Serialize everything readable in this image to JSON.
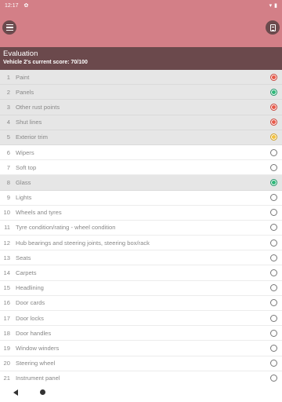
{
  "status_bar": {
    "time": "12:17"
  },
  "header": {
    "title": "Evaluation",
    "score_text": "Vehicle 2's current score: 70/100"
  },
  "items": [
    {
      "num": "1",
      "label": "Paint",
      "status": "red"
    },
    {
      "num": "2",
      "label": "Panels",
      "status": "green"
    },
    {
      "num": "3",
      "label": "Other rust points",
      "status": "red"
    },
    {
      "num": "4",
      "label": "Shut lines",
      "status": "red"
    },
    {
      "num": "5",
      "label": "Exterior trim",
      "status": "yellow"
    },
    {
      "num": "6",
      "label": "Wipers",
      "status": "empty"
    },
    {
      "num": "7",
      "label": "Soft top",
      "status": "empty"
    },
    {
      "num": "8",
      "label": "Glass",
      "status": "green"
    },
    {
      "num": "9",
      "label": "Lights",
      "status": "empty"
    },
    {
      "num": "10",
      "label": "Wheels and tyres",
      "status": "empty"
    },
    {
      "num": "11",
      "label": "Tyre condition/rating - wheel condition",
      "status": "empty"
    },
    {
      "num": "12",
      "label": "Hub bearings and steering joints, steering box/rack",
      "status": "empty"
    },
    {
      "num": "13",
      "label": "Seats",
      "status": "empty"
    },
    {
      "num": "14",
      "label": "Carpets",
      "status": "empty"
    },
    {
      "num": "15",
      "label": "Headlining",
      "status": "empty"
    },
    {
      "num": "16",
      "label": "Door cards",
      "status": "empty"
    },
    {
      "num": "17",
      "label": "Door locks",
      "status": "empty"
    },
    {
      "num": "18",
      "label": "Door handles",
      "status": "empty"
    },
    {
      "num": "19",
      "label": "Window winders",
      "status": "empty"
    },
    {
      "num": "20",
      "label": "Steering wheel",
      "status": "empty"
    },
    {
      "num": "21",
      "label": "Instrument panel",
      "status": "empty"
    }
  ],
  "icons": {
    "menu": "hamburger-menu-icon",
    "report": "document-icon",
    "nav_back": "back-triangle-icon",
    "nav_home": "home-circle-icon"
  },
  "colors": {
    "app_bar": "#d37f87",
    "header_bg": "#6b494c",
    "red": "#e85a4a",
    "green": "#2fb879",
    "yellow": "#f2c13e"
  }
}
